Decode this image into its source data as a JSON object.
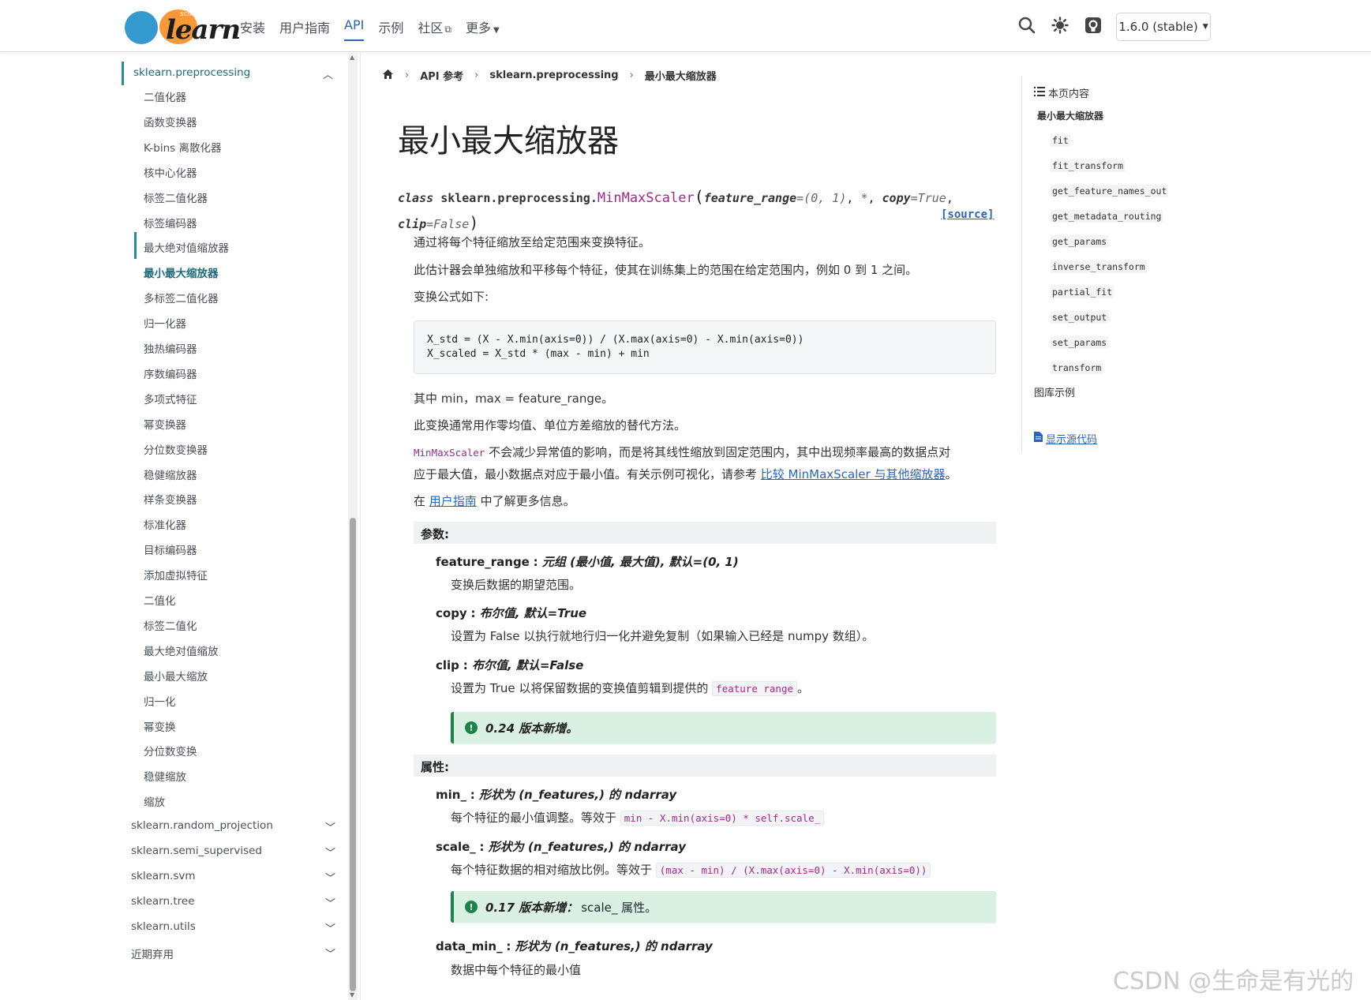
{
  "header": {
    "logo_small": "scikit",
    "logo_word": "learn",
    "nav": [
      {
        "label": "安装"
      },
      {
        "label": "用户指南"
      },
      {
        "label": "API"
      },
      {
        "label": "示例"
      },
      {
        "label": "社区"
      },
      {
        "label": "更多"
      }
    ],
    "version": "1.6.0 (stable)"
  },
  "sidebar": {
    "section": "sklearn.preprocessing",
    "items": [
      "二值化器",
      "函数变换器",
      "K-bins 离散化器",
      "核中心化器",
      "标签二值化器",
      "标签编码器",
      "最大绝对值缩放器",
      "最小最大缩放器",
      "多标签二值化器",
      "归一化器",
      "独热编码器",
      "序数编码器",
      "多项式特征",
      "幂变换器",
      "分位数变换器",
      "稳健缩放器",
      "样条变换器",
      "标准化器",
      "目标编码器",
      "添加虚拟特征",
      "二值化",
      "标签二值化",
      "最大绝对值缩放",
      "最小最大缩放",
      "归一化",
      "幂变换",
      "分位数变换",
      "稳健缩放",
      "缩放"
    ],
    "active_index": 7,
    "modules": [
      "sklearn.random_projection",
      "sklearn.semi_supervised",
      "sklearn.svm",
      "sklearn.tree",
      "sklearn.utils",
      "近期弃用"
    ]
  },
  "breadcrumb": {
    "items": [
      "API 参考",
      "sklearn.preprocessing",
      "最小最大缩放器"
    ]
  },
  "main": {
    "title": "最小最大缩放器",
    "signature": {
      "kw": "class",
      "module": "sklearn.preprocessing.",
      "cls": "MinMaxScaler",
      "p1_name": "feature_range",
      "p1_val": "=(0, 1)",
      "star": "*",
      "p2_name": "copy",
      "p2_val": "=True",
      "p3_name": "clip",
      "p3_val": "=False",
      "source": "[source]"
    },
    "para1": "通过将每个特征缩放至给定范围来变换特征。",
    "para2": "此估计器会单独缩放和平移每个特征，使其在训练集上的范围在给定范围内，例如 0 到 1 之间。",
    "para3": "变换公式如下:",
    "code_line1": "X_std = (X - X.min(axis=0)) / (X.max(axis=0) - X.min(axis=0))",
    "code_line2": "X_scaled = X_std * (max - min) + min",
    "para4": "其中 min，max = feature_range。",
    "para5": "此变换通常用作零均值、单位方差缩放的替代方法。",
    "para6_code": "MinMaxScaler",
    "para6_text": " 不会减少异常值的影响，而是将其线性缩放到固定范围内，其中出现频率最高的数据点对",
    "para7_text": "应于最大值，最小数据点对应于最小值。有关示例可视化，请参考 ",
    "para7_link": "比较 MinMaxScaler 与其他缩放器",
    "para7_end": "。",
    "para8_pre": "在 ",
    "para8_link": "用户指南",
    "para8_post": " 中了解更多信息。",
    "params_head": "参数:",
    "params": [
      {
        "name": "feature_range",
        "type": "元组 (最小值, 最大值), 默认=(0, 1)",
        "desc": "变换后数据的期望范围。"
      },
      {
        "name": "copy",
        "type": "布尔值, 默认=True",
        "desc": "设置为 False 以执行就地行归一化并避免复制（如果输入已经是 numpy 数组）。"
      },
      {
        "name": "clip",
        "type": "布尔值, 默认=False",
        "desc_pre": "设置为 True 以将保留数据的变换值剪辑到提供的 ",
        "desc_code": "feature range",
        "desc_post": "。"
      }
    ],
    "version_added_1": "0.24 版本新增。",
    "attrs_head": "属性:",
    "attrs": [
      {
        "name": "min_",
        "type": "形状为 (n_features,) 的 ndarray",
        "desc_pre": "每个特征的最小值调整。等效于 ",
        "desc_code": "min - X.min(axis=0) * self.scale_"
      },
      {
        "name": "scale_",
        "type": "形状为 (n_features,) 的 ndarray",
        "desc_pre": "每个特征数据的相对缩放比例。等效于 ",
        "desc_code": "(max - min) / (X.max(axis=0) - X.min(axis=0))"
      },
      {
        "name": "data_min_",
        "type": "形状为 (n_features,) 的 ndarray",
        "desc_pre": "数据中每个特征的最小值"
      }
    ],
    "version_added_2": "0.17 版本新增：",
    "version_added_2_rest": "scale_ 属性。"
  },
  "toc": {
    "title": "本页内容",
    "main": "最小最大缩放器",
    "items": [
      "fit",
      "fit_transform",
      "get_feature_names_out",
      "get_metadata_routing",
      "get_params",
      "inverse_transform",
      "partial_fit",
      "set_output",
      "set_params",
      "transform"
    ],
    "gallery": "图库示例",
    "show_source": "显示源代码"
  },
  "watermark": "CSDN @生命是有光的"
}
